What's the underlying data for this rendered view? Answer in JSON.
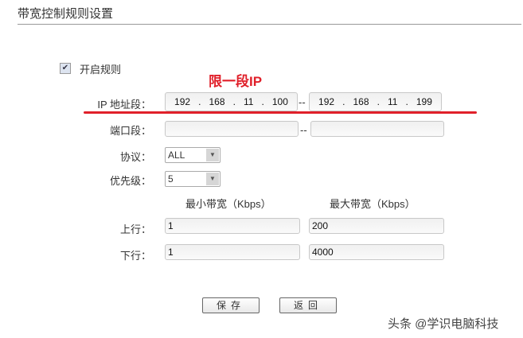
{
  "page_title": "带宽控制规则设置",
  "enable_rule": {
    "label": "开启规则",
    "checked": true
  },
  "annotation": "限一段IP",
  "annotation_color": "#e0202a",
  "ip_range": {
    "label": "IP 地址段：",
    "start": [
      "192",
      "168",
      "11",
      "100"
    ],
    "end": [
      "192",
      "168",
      "11",
      "199"
    ],
    "sep": "--",
    "dot": "."
  },
  "port_range": {
    "label": "端口段：",
    "start": "",
    "end": "",
    "sep": "--"
  },
  "protocol": {
    "label": "协议：",
    "value": "ALL"
  },
  "priority": {
    "label": "优先级：",
    "value": "5"
  },
  "bandwidth": {
    "min_header": "最小带宽（Kbps）",
    "max_header": "最大带宽（Kbps）",
    "up": {
      "label": "上行：",
      "min": "1",
      "max": "200"
    },
    "down": {
      "label": "下行：",
      "min": "1",
      "max": "4000"
    }
  },
  "buttons": {
    "save": "保存",
    "back": "返回"
  },
  "watermark": "头条 @学识电脑科技"
}
